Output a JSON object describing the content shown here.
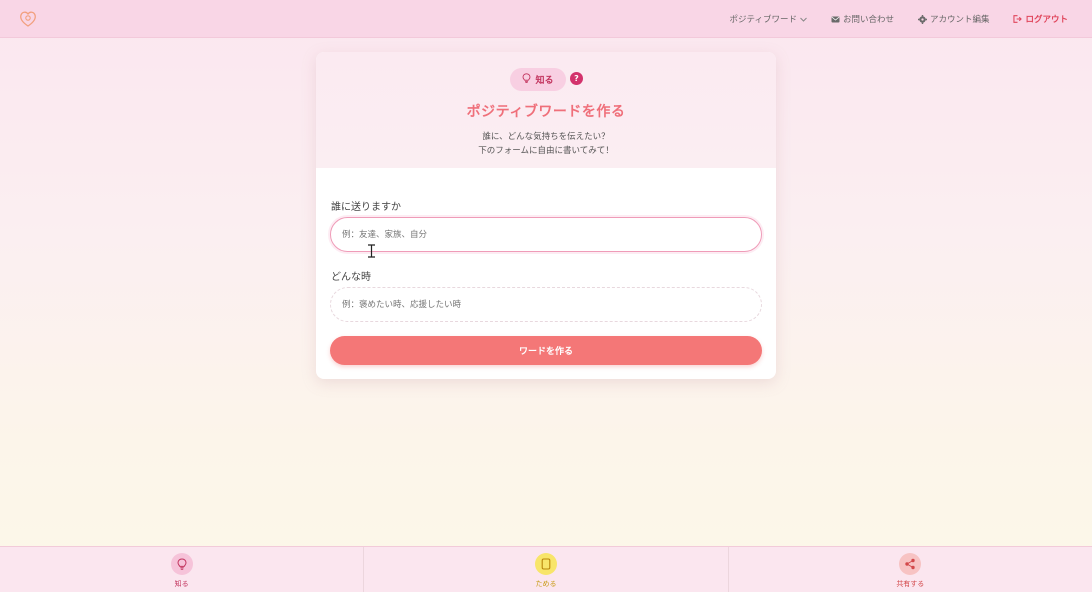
{
  "header": {
    "nav": {
      "positive_words": "ポジティブワード",
      "contact": "お問い合わせ",
      "account": "アカウント編集",
      "logout": "ログアウト"
    }
  },
  "card": {
    "mode_pill": "知る",
    "help": "?",
    "title": "ポジティブワードを作る",
    "subtitle_line1": "誰に、どんな気持ちを伝えたい？",
    "subtitle_line2": "下のフォームに自由に書いてみて！",
    "field1": {
      "label": "誰に送りますか",
      "placeholder": "例：友達、家族、自分",
      "value": ""
    },
    "field2": {
      "label": "どんな時",
      "placeholder": "例：褒めたい時、応援したい時",
      "value": ""
    },
    "submit": "ワードを作る"
  },
  "bottom_nav": {
    "tabs": [
      {
        "label": "知る",
        "icon": "lightbulb-icon"
      },
      {
        "label": "ためる",
        "icon": "note-icon"
      },
      {
        "label": "共有する",
        "icon": "share-icon"
      }
    ]
  },
  "colors": {
    "accent": "#f47777",
    "title": "#ef6f7a",
    "logout": "#e0455b",
    "header_bg": "#f9d6e6"
  }
}
